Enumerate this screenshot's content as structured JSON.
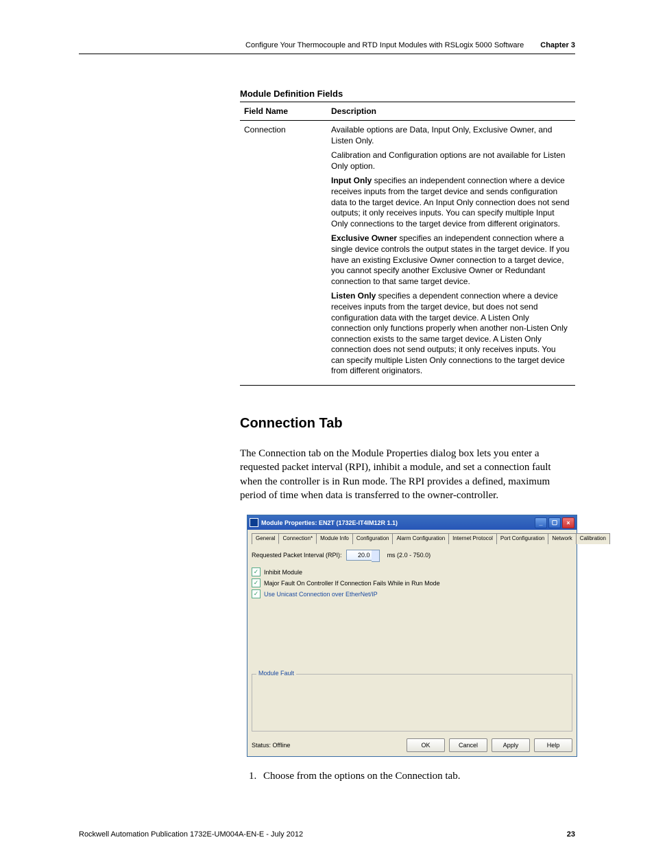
{
  "header": {
    "subtitle": "Configure Your Thermocouple and RTD Input Modules with RSLogix 5000 Software",
    "chapter": "Chapter 3"
  },
  "table": {
    "title": "Module Definition Fields",
    "head": {
      "field_name": "Field Name",
      "description": "Description"
    },
    "row": {
      "field": "Connection",
      "p1": "Available options are Data, Input Only, Exclusive Owner, and Listen Only.",
      "p2": "Calibration and Configuration options are not available for Listen Only option.",
      "p3_bold": "Input Only",
      "p3_rest": " specifies an independent connection where a device receives inputs from the target device and sends configuration data to the target device. An Input Only connection does not send outputs; it only receives inputs. You can specify multiple Input Only connections to the target device from different originators.",
      "p4_bold": "Exclusive Owner",
      "p4_rest": " specifies an independent connection where a single device controls the output states in the target device. If you have an existing Exclusive Owner connection to a target device, you cannot specify another Exclusive Owner or Redundant connection to that same target device.",
      "p5_bold": "Listen Only",
      "p5_rest": " specifies a dependent connection where a device receives inputs from the target device, but does not send configuration data with the target device. A Listen Only connection only functions properly when another non-Listen Only connection exists to the same target device. A Listen Only connection does not send outputs; it only receives inputs. You can specify multiple Listen Only connections to the target device from different originators."
    }
  },
  "section": {
    "heading": "Connection Tab",
    "body": "The Connection tab on the Module Properties dialog box lets you enter a requested packet interval (RPI), inhibit a module, and set a connection fault when the controller is in Run mode. The RPI provides a defined, maximum period of time when data is transferred to the owner-controller."
  },
  "dialog": {
    "title": "Module Properties: EN2T (1732E-IT4IM12R 1.1)",
    "tabs": {
      "general": "General",
      "connection": "Connection*",
      "module_info": "Module Info",
      "configuration": "Configuration",
      "alarm_configuration": "Alarm Configuration",
      "internet_protocol": "Internet Protocol",
      "port_configuration": "Port Configuration",
      "network": "Network",
      "calibration": "Calibration"
    },
    "rpi_label": "Requested Packet Interval (RPI):",
    "rpi_value": "20.0",
    "rpi_range": "ms  (2.0 - 750.0)",
    "chk_inhibit": "Inhibit Module",
    "chk_major_fault": "Major Fault On Controller If Connection Fails While in Run Mode",
    "chk_unicast": "Use Unicast Connection over EtherNet/IP",
    "fault_legend": "Module Fault",
    "status_label": "Status: Offline",
    "buttons": {
      "ok": "OK",
      "cancel": "Cancel",
      "apply": "Apply",
      "help": "Help"
    }
  },
  "step1": "Choose from the options on the Connection tab.",
  "footer": {
    "publication": "Rockwell Automation Publication 1732E-UM004A-EN-E - July 2012",
    "page": "23"
  }
}
